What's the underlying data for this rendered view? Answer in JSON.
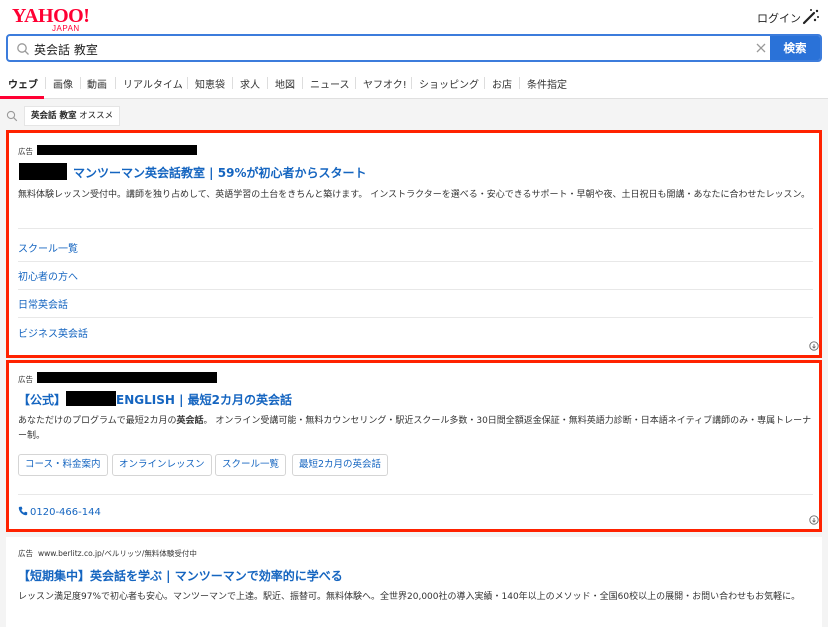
{
  "header": {
    "logo_main": "YAHOO!",
    "logo_sub": "JAPAN",
    "login_label": "ログイン",
    "tool_icon": "magic-wand-icon"
  },
  "search": {
    "query": "英会話 教室",
    "button_label": "検索"
  },
  "tabs": [
    {
      "label": "ウェブ",
      "active": true
    },
    {
      "label": "画像"
    },
    {
      "label": "動画"
    },
    {
      "label": "リアルタイム"
    },
    {
      "label": "知恵袋"
    },
    {
      "label": "求人"
    },
    {
      "label": "地図"
    },
    {
      "label": "ニュース"
    },
    {
      "label": "ヤフオク!"
    },
    {
      "label": "ショッピング"
    },
    {
      "label": "お店"
    },
    {
      "label": "条件指定"
    }
  ],
  "suggestion": {
    "bold": "英会話 教室",
    "rest": " オススメ"
  },
  "ad1": {
    "label": "広告",
    "title": "マンツーマン英会話教室 | 59%が初心者からスタート",
    "description": "無料体験レッスン受付中。講師を独り占めして、英語学習の土台をきちんと築けます。 インストラクターを選べる・安心できるサポート・早朝や夜、土日祝日も開講・あなたに合わせたレッスン。",
    "sitelinks": [
      "スクール一覧",
      "初心者の方へ",
      "日常英会話",
      "ビジネス英会話"
    ]
  },
  "ad2": {
    "label": "広告",
    "title_prefix": "【公式】",
    "title_suffix": "ENGLISH | 最短2カ月の英会話",
    "desc_before": "あなただけのプログラムで最短2カ月の",
    "desc_bold": "英会話",
    "desc_after": "。 オンライン受講可能・無料カウンセリング・駅近スクール多数・30日間全額返金保証・無料英語力診断・日本語ネイティブ講師のみ・専属トレーナー制。",
    "chips": [
      "コース・料金案内",
      "オンラインレッスン",
      "スクール一覧",
      "最短2カ月の英会話"
    ],
    "phone": "0120-466-144"
  },
  "ad3": {
    "label": "広告",
    "url": "www.berlitz.co.jp/ベルリッツ/無料体験受付中",
    "title": "【短期集中】英会話を学ぶ | マンツーマンで効率的に学べる",
    "description": "レッスン満足度97%で初心者も安心。マンツーマンで上達。駅近、振替可。無料体験へ。全世界20,000社の導入実績・140年以上のメソッド・全国60校以上の展開・お問い合わせもお気軽に。"
  },
  "colors": {
    "brand": "#ff0033",
    "link": "#1565c0",
    "search_button": "#2a72d8",
    "highlight_border": "#ff2200"
  }
}
